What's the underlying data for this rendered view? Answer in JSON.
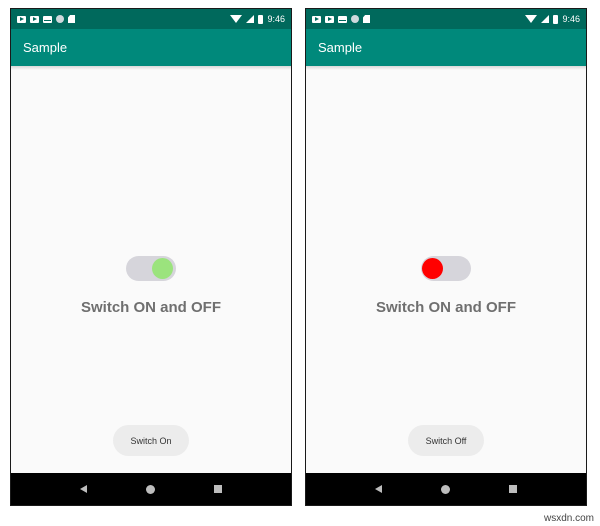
{
  "screens": [
    {
      "status_time": "9:46",
      "app_title": "Sample",
      "switch_state": "on",
      "switch_color": "#9be37d",
      "label": "Switch ON and OFF",
      "button_label": "Switch On"
    },
    {
      "status_time": "9:46",
      "app_title": "Sample",
      "switch_state": "off",
      "switch_color": "#ff0000",
      "label": "Switch ON and OFF",
      "button_label": "Switch Off"
    }
  ],
  "colors": {
    "status_bar": "#00695c",
    "app_bar": "#00897b",
    "switch_track": "#d6d5db"
  },
  "icons": [
    "youtube-icon",
    "youtube-icon",
    "mail-icon",
    "circle-icon",
    "sd-card-icon",
    "wifi-icon",
    "signal-icon",
    "battery-icon",
    "back-icon",
    "home-icon",
    "recents-icon"
  ],
  "watermark": "wsxdn.com"
}
